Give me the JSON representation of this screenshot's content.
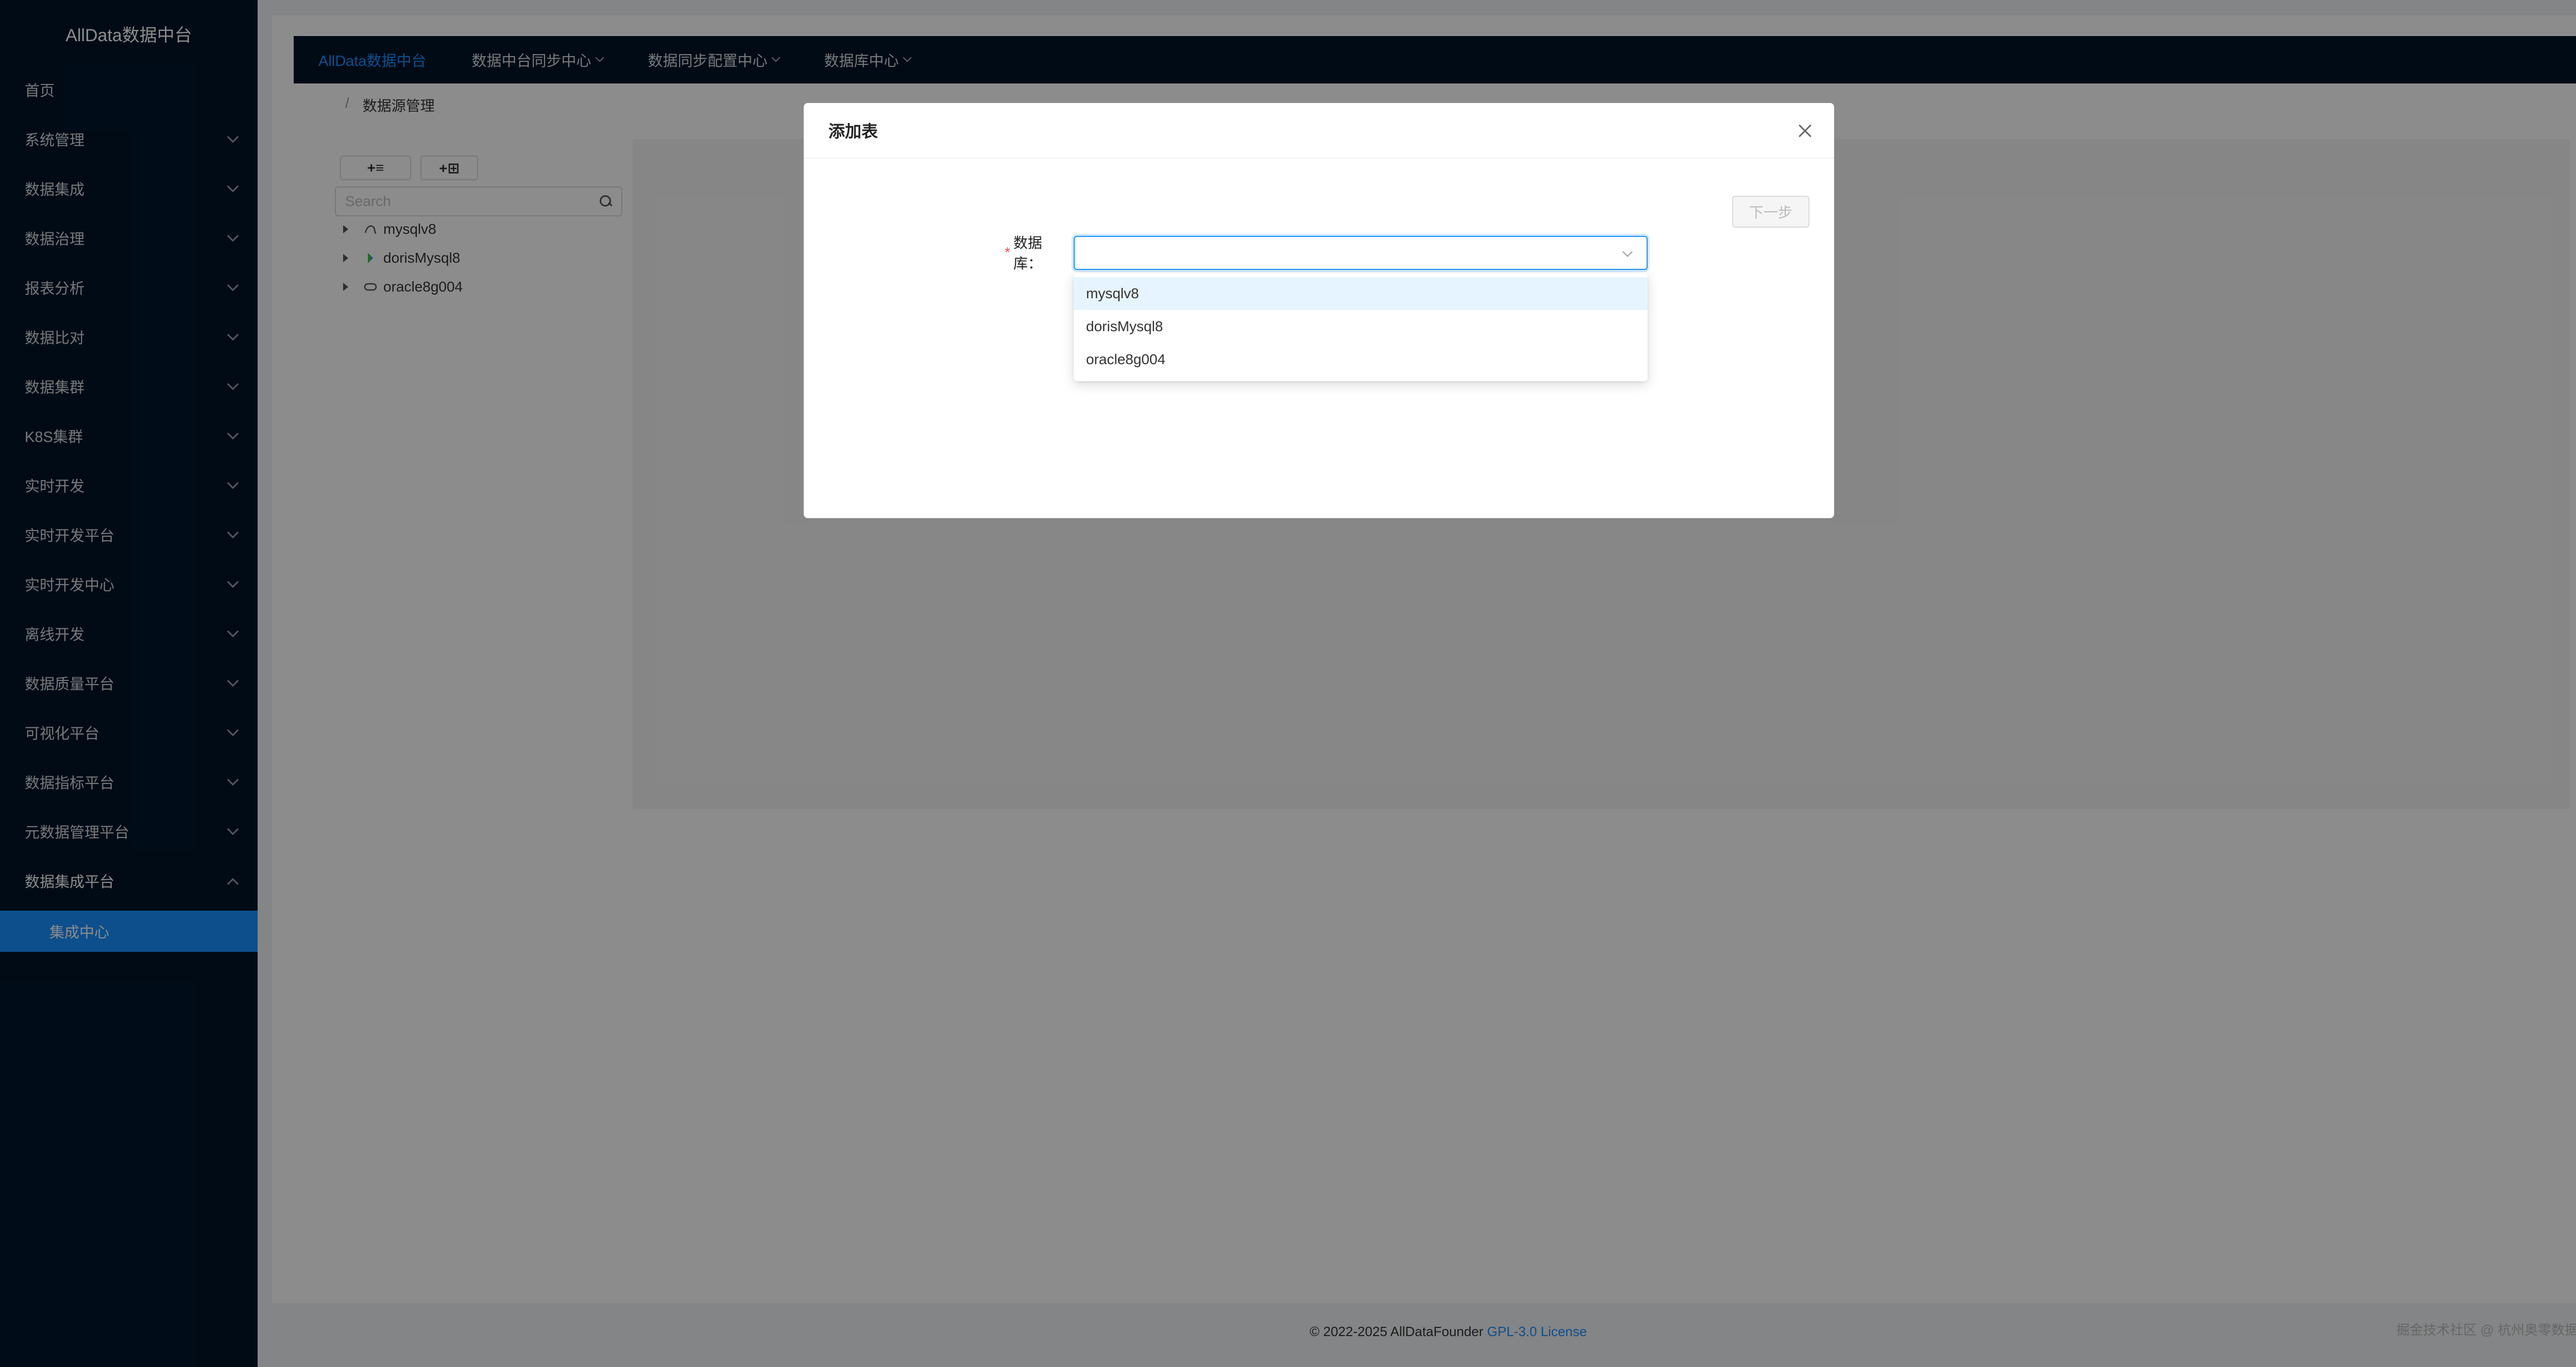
{
  "app": {
    "title": "AllData数据中台"
  },
  "sidebar": {
    "items": [
      {
        "label": "首页"
      },
      {
        "label": "系统管理"
      },
      {
        "label": "数据集成"
      },
      {
        "label": "数据治理"
      },
      {
        "label": "报表分析"
      },
      {
        "label": "数据比对"
      },
      {
        "label": "数据集群"
      },
      {
        "label": "K8S集群"
      },
      {
        "label": "实时开发"
      },
      {
        "label": "实时开发平台"
      },
      {
        "label": "实时开发中心"
      },
      {
        "label": "离线开发"
      },
      {
        "label": "数据质量平台"
      },
      {
        "label": "可视化平台"
      },
      {
        "label": "数据指标平台"
      },
      {
        "label": "元数据管理平台"
      },
      {
        "label": "数据集成平台"
      }
    ],
    "active_sub": "集成中心"
  },
  "topnav": {
    "items": [
      {
        "label": "AllData数据中台"
      },
      {
        "label": "数据中台同步中心"
      },
      {
        "label": "数据同步配置中心"
      },
      {
        "label": "数据库中心"
      }
    ]
  },
  "breadcrumb": {
    "separator": "/",
    "current": "数据源管理"
  },
  "toolbar": {
    "add_db_label": "+≡",
    "add_table_label": "+⊞"
  },
  "search": {
    "placeholder": "Search"
  },
  "tree": {
    "nodes": [
      {
        "label": "mysqlv8",
        "icon": "mysql-icon"
      },
      {
        "label": "dorisMysql8",
        "icon": "doris-icon"
      },
      {
        "label": "oracle8g004",
        "icon": "oracle-icon"
      }
    ]
  },
  "modal": {
    "title": "添加表",
    "next_label": "下一步",
    "field_label": "数据库：",
    "required_mark": "*",
    "options": [
      "mysqlv8",
      "dorisMysql8",
      "oracle8g004"
    ]
  },
  "footer": {
    "copyright": "© 2022-2025 AllDataFounder",
    "license": "GPL-3.0 License"
  },
  "watermark": "掘金技术社区 @ 杭州奥零数据科技",
  "colors": {
    "accent": "#1890ff",
    "sidebar_bg": "#001529",
    "required": "#ff4d4f"
  }
}
